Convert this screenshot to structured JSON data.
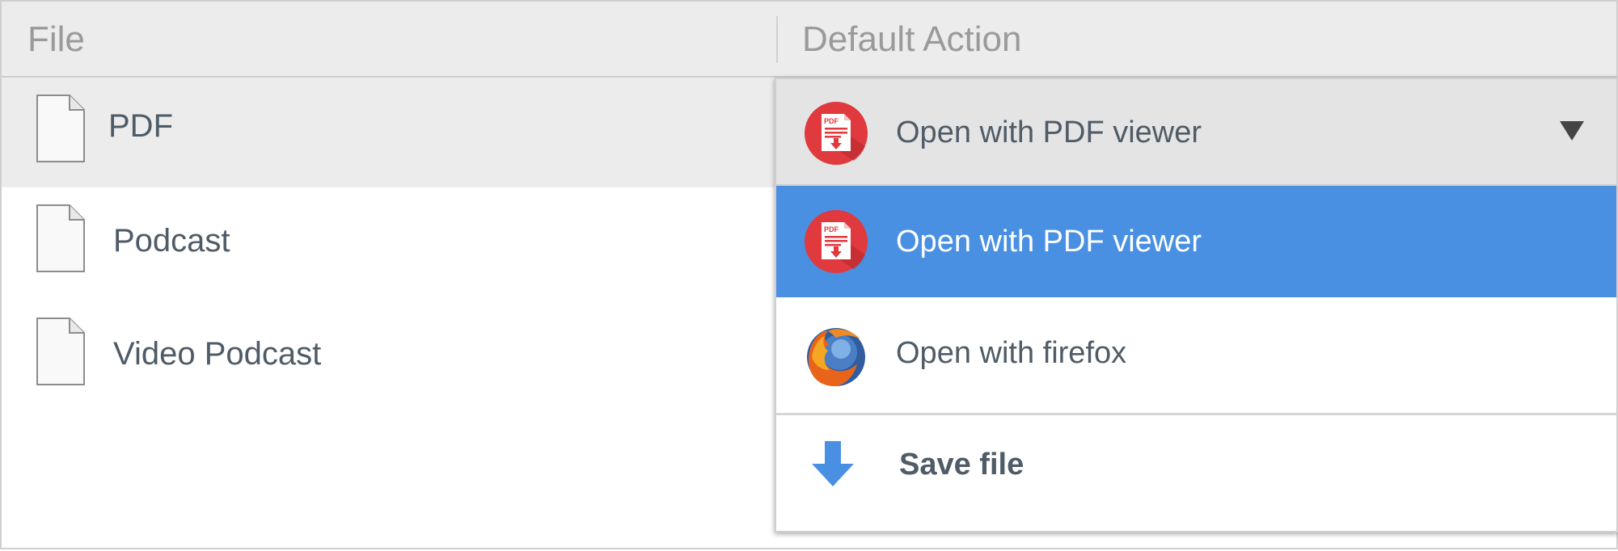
{
  "header": {
    "file_label": "File",
    "action_label": "Default Action"
  },
  "rows": [
    {
      "label": "PDF",
      "icon": "document-icon",
      "selected": true
    },
    {
      "label": "Podcast",
      "icon": "document-icon",
      "selected": false
    },
    {
      "label": "Video Podcast",
      "icon": "document-icon",
      "selected": false
    }
  ],
  "dropdown": {
    "selected_value": "Open with PDF viewer",
    "options": [
      {
        "label": "Open with PDF viewer",
        "icon": "pdf-icon",
        "highlighted": true
      },
      {
        "label": "Open with firefox",
        "icon": "firefox-icon",
        "highlighted": false
      },
      {
        "label": "Save file",
        "icon": "download-arrow-icon",
        "highlighted": false
      }
    ]
  },
  "icon_text": {
    "pdf_badge": "PDF"
  },
  "colors": {
    "highlight": "#4a90e2",
    "pdf_red": "#e0393e",
    "download_blue": "#4a90e2",
    "text": "#4f5b66"
  }
}
